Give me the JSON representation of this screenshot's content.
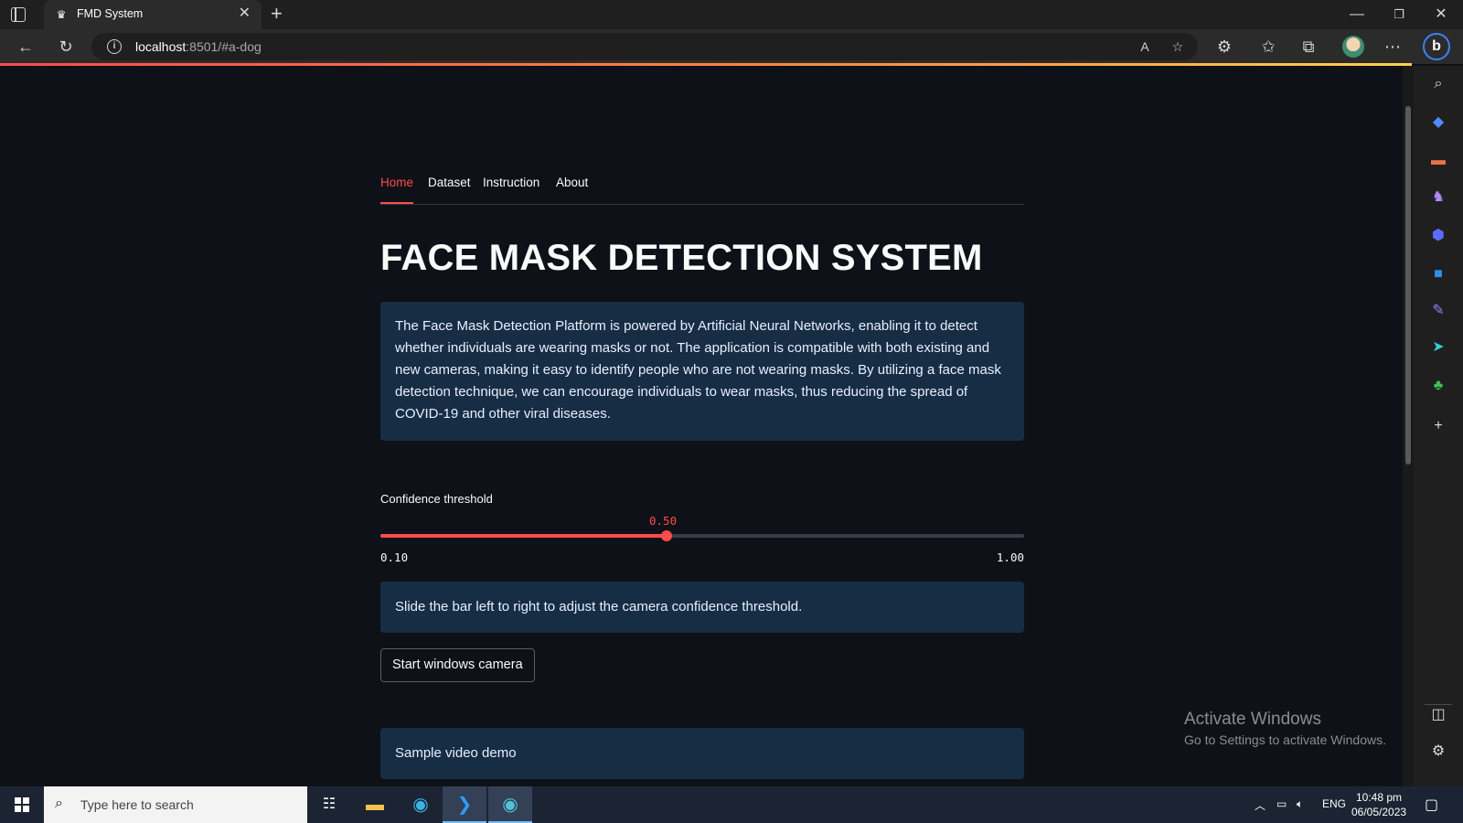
{
  "browser": {
    "tab_title": "FMD System",
    "url_host": "localhost",
    "url_rest": ":8501/#a-dog"
  },
  "app": {
    "nav_tabs": [
      "Home",
      "Dataset",
      "Instruction",
      "About"
    ],
    "active_tab": "Home",
    "title": "FACE MASK DETECTION SYSTEM",
    "description": "The Face Mask Detection Platform is powered by Artificial Neural Networks, enabling it to detect whether individuals are wearing masks or not. The application is compatible with both existing and new cameras, making it easy to identify people who are not wearing masks. By utilizing a face mask detection technique, we can encourage individuals to wear masks, thus reducing the spread of COVID-19 and other viral diseases.",
    "slider": {
      "label": "Confidence threshold",
      "value": 0.5,
      "value_text": "0.50",
      "min": 0.1,
      "max": 1.0,
      "min_text": "0.10",
      "max_text": "1.00"
    },
    "slider_hint": "Slide the bar left to right to adjust the camera confidence threshold.",
    "camera_button": "Start windows camera",
    "demo_heading": "Sample video demo"
  },
  "watermark": {
    "title": "Activate Windows",
    "subtitle": "Go to Settings to activate Windows."
  },
  "taskbar": {
    "search_placeholder": "Type here to search",
    "language": "ENG",
    "time": "10:48 pm",
    "date": "06/05/2023"
  },
  "colors": {
    "accent": "#ff4b4b",
    "background": "#0e1117",
    "info_box": "#172d43"
  }
}
